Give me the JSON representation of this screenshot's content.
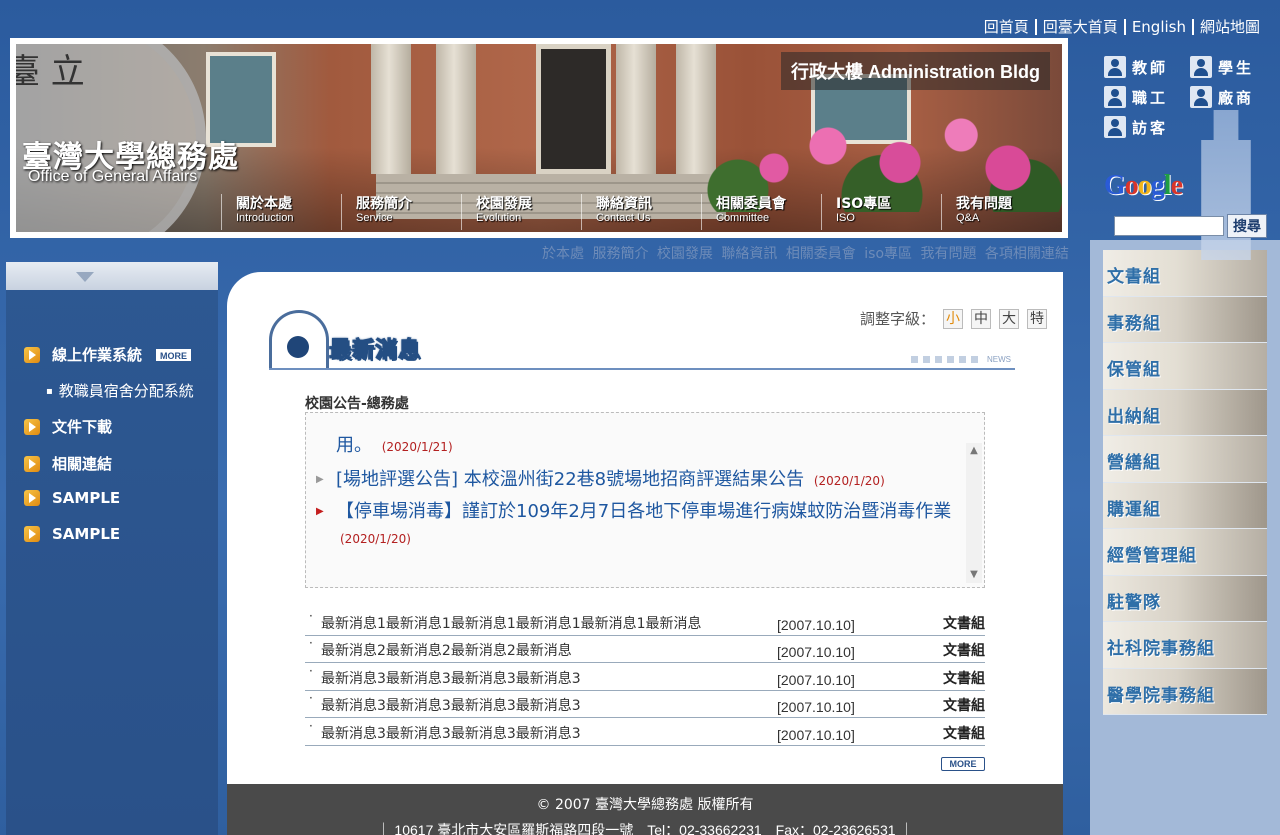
{
  "top_links": [
    "回首頁",
    "回臺大首頁",
    "English",
    "網站地圖"
  ],
  "banner": {
    "seal_text": "臺 立",
    "logo_cn": "臺灣大學總務處",
    "logo_en": "Office of General Affairs",
    "building_label": "行政大樓 Administration Bldg",
    "nav": [
      {
        "cn": "關於本處",
        "en": "Introduction"
      },
      {
        "cn": "服務簡介",
        "en": "Service"
      },
      {
        "cn": "校園發展",
        "en": "Evolution"
      },
      {
        "cn": "聯絡資訊",
        "en": "Contact Us"
      },
      {
        "cn": "相關委員會",
        "en": "Committee"
      },
      {
        "cn": "ISO專區",
        "en": "ISO"
      },
      {
        "cn": "我有問題",
        "en": "Q&A"
      }
    ]
  },
  "roles": [
    "教師",
    "學生",
    "職工",
    "廠商",
    "訪客"
  ],
  "search": {
    "logo": "Google",
    "button": "搜尋",
    "placeholder": ""
  },
  "text_nav": [
    "於本處",
    "服務簡介",
    "校園發展",
    "聯絡資訊",
    "相關委員會",
    "iso專區",
    "我有問題",
    "各項相關連結"
  ],
  "left_nav": {
    "items": [
      "線上作業系統",
      "文件下載",
      "相關連結",
      "SAMPLE",
      "SAMPLE"
    ],
    "more_label": "MORE",
    "sub_item": "教職員宿舍分配系統"
  },
  "main": {
    "font_size_label": "調整字級：",
    "font_sizes": [
      "小",
      "中",
      "大",
      "特"
    ],
    "title": "最新消息",
    "news_tag": "NEWS",
    "section_label": "校園公告-總務處",
    "announcements": [
      {
        "text": "用。",
        "date": "(2020/1/21)"
      },
      {
        "text": "[場地評選公告] 本校溫州街22巷8號場地招商評選結果公告",
        "date": "(2020/1/20)"
      },
      {
        "text": "【停車場消毒】謹訂於109年2月7日各地下停車場進行病媒蚊防治暨消毒作業",
        "date": "(2020/1/20)"
      }
    ],
    "news_rows": [
      {
        "title": "最新消息1最新消息1最新消息1最新消息1最新消息1最新消息",
        "date": "[2007.10.10]",
        "group": "文書組"
      },
      {
        "title": "最新消息2最新消息2最新消息2最新消息",
        "date": "[2007.10.10]",
        "group": "文書組"
      },
      {
        "title": "最新消息3最新消息3最新消息3最新消息3",
        "date": "[2007.10.10]",
        "group": "文書組"
      },
      {
        "title": "最新消息3最新消息3最新消息3最新消息3",
        "date": "[2007.10.10]",
        "group": "文書組"
      },
      {
        "title": "最新消息3最新消息3最新消息3最新消息3",
        "date": "[2007.10.10]",
        "group": "文書組"
      }
    ],
    "more_label": "MORE"
  },
  "footer": {
    "copyright": "© 2007 臺灣大學總務處 版權所有",
    "address": "｜ 10617 臺北市大安區羅斯福路四段一號　Tel：02-33662231　Fax：02-23626531 ｜"
  },
  "departments": [
    "文書組",
    "事務組",
    "保管組",
    "出納組",
    "營繕組",
    "購運組",
    "經營管理組",
    "駐警隊",
    "社科院事務組",
    "醫學院事務組"
  ]
}
